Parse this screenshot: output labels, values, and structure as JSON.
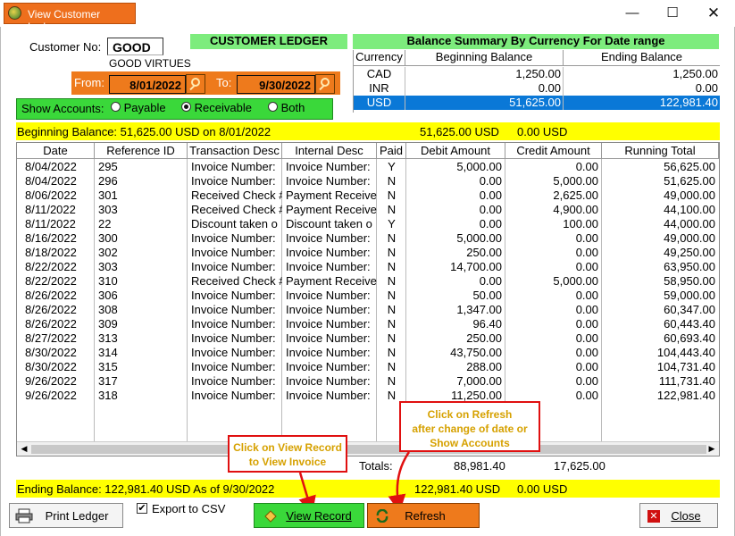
{
  "window": {
    "title": "View Customer Ledger",
    "min_glyph": "—",
    "max_glyph": "☐",
    "close_glyph": "✕"
  },
  "customer": {
    "no_label": "Customer No:",
    "no_value": "GOOD",
    "name": "GOOD VIRTUES"
  },
  "date_range": {
    "from_label": "From:",
    "from_value": "8/01/2022",
    "to_label": "To:",
    "to_value": "9/30/2022"
  },
  "show_accounts": {
    "label": "Show Accounts:",
    "options": [
      "Payable",
      "Receivable",
      "Both"
    ],
    "selected": "Receivable"
  },
  "headers": {
    "customer_ledger": "CUSTOMER LEDGER",
    "balance_summary": "Balance Summary By Currency For Date range"
  },
  "currency_summary": {
    "columns": [
      "Currency",
      "Beginning Balance",
      "Ending Balance"
    ],
    "rows": [
      {
        "currency": "CAD",
        "beginning": "1,250.00",
        "ending": "1,250.00",
        "selected": false
      },
      {
        "currency": "INR",
        "beginning": "0.00",
        "ending": "0.00",
        "selected": false
      },
      {
        "currency": "USD",
        "beginning": "51,625.00",
        "ending": "122,981.40",
        "selected": true
      }
    ]
  },
  "beginning_balance": {
    "text": "Beginning Balance: 51,625.00 USD   on 8/01/2022",
    "amount1": "51,625.00 USD",
    "amount2": "0.00 USD"
  },
  "ledger": {
    "columns": [
      "Date",
      "Reference ID",
      "Transaction Desc",
      "Internal Desc",
      "Paid",
      "Debit Amount",
      "Credit Amount",
      "Running Total"
    ],
    "rows": [
      [
        "8/04/2022",
        "295",
        "Invoice Number:",
        "Invoice Number:",
        "Y",
        "5,000.00",
        "0.00",
        "56,625.00"
      ],
      [
        "8/04/2022",
        "296",
        "Invoice Number:",
        "Invoice Number:",
        "N",
        "0.00",
        "5,000.00",
        "51,625.00"
      ],
      [
        "8/06/2022",
        "301",
        "Received Check #",
        "Payment Receive",
        "N",
        "0.00",
        "2,625.00",
        "49,000.00"
      ],
      [
        "8/11/2022",
        "303",
        "Received Check #",
        "Payment Receive",
        "N",
        "0.00",
        "4,900.00",
        "44,100.00"
      ],
      [
        "8/11/2022",
        "22",
        "Discount taken o",
        "Discount taken o",
        "Y",
        "0.00",
        "100.00",
        "44,000.00"
      ],
      [
        "8/16/2022",
        "300",
        "Invoice Number:",
        "Invoice Number:",
        "N",
        "5,000.00",
        "0.00",
        "49,000.00"
      ],
      [
        "8/18/2022",
        "302",
        "Invoice Number:",
        "Invoice Number:",
        "N",
        "250.00",
        "0.00",
        "49,250.00"
      ],
      [
        "8/22/2022",
        "303",
        "Invoice Number:",
        "Invoice Number:",
        "N",
        "14,700.00",
        "0.00",
        "63,950.00"
      ],
      [
        "8/22/2022",
        "310",
        "Received Check #",
        "Payment Receive",
        "N",
        "0.00",
        "5,000.00",
        "58,950.00"
      ],
      [
        "8/26/2022",
        "306",
        "Invoice Number:",
        "Invoice Number:",
        "N",
        "50.00",
        "0.00",
        "59,000.00"
      ],
      [
        "8/26/2022",
        "308",
        "Invoice Number:",
        "Invoice Number:",
        "N",
        "1,347.00",
        "0.00",
        "60,347.00"
      ],
      [
        "8/26/2022",
        "309",
        "Invoice Number:",
        "Invoice Number:",
        "N",
        "96.40",
        "0.00",
        "60,443.40"
      ],
      [
        "8/27/2022",
        "313",
        "Invoice Number:",
        "Invoice Number:",
        "N",
        "250.00",
        "0.00",
        "60,693.40"
      ],
      [
        "8/30/2022",
        "314",
        "Invoice Number:",
        "Invoice Number:",
        "N",
        "43,750.00",
        "0.00",
        "104,443.40"
      ],
      [
        "8/30/2022",
        "315",
        "Invoice Number:",
        "Invoice Number:",
        "N",
        "288.00",
        "0.00",
        "104,731.40"
      ],
      [
        "9/26/2022",
        "317",
        "Invoice Number:",
        "Invoice Number:",
        "N",
        "7,000.00",
        "0.00",
        "111,731.40"
      ],
      [
        "9/26/2022",
        "318",
        "Invoice Number:",
        "Invoice Number:",
        "N",
        "11,250.00",
        "0.00",
        "122,981.40"
      ]
    ]
  },
  "totals": {
    "label": "Totals:",
    "debit": "88,981.40",
    "credit": "17,625.00"
  },
  "ending_balance": {
    "text": "Ending Balance: 122,981.40 USD   As of 9/30/2022",
    "amount1": "122,981.40 USD",
    "amount2": "0.00 USD"
  },
  "callouts": {
    "view_record": [
      "Click on View Record",
      "to View Invoice"
    ],
    "refresh": [
      "Click on Refresh",
      "after change of date or",
      "Show Accounts"
    ]
  },
  "buttons": {
    "print_ledger": "Print Ledger",
    "export_csv": "Export to CSV",
    "export_checked": true,
    "view_record": "View Record",
    "refresh": "Refresh",
    "close": "Close"
  },
  "colors": {
    "orange": "#ee7a1c",
    "green": "#7dec7d",
    "yellow": "#ffff00",
    "select_blue": "#0a78d7",
    "callout_red": "#e01010"
  }
}
